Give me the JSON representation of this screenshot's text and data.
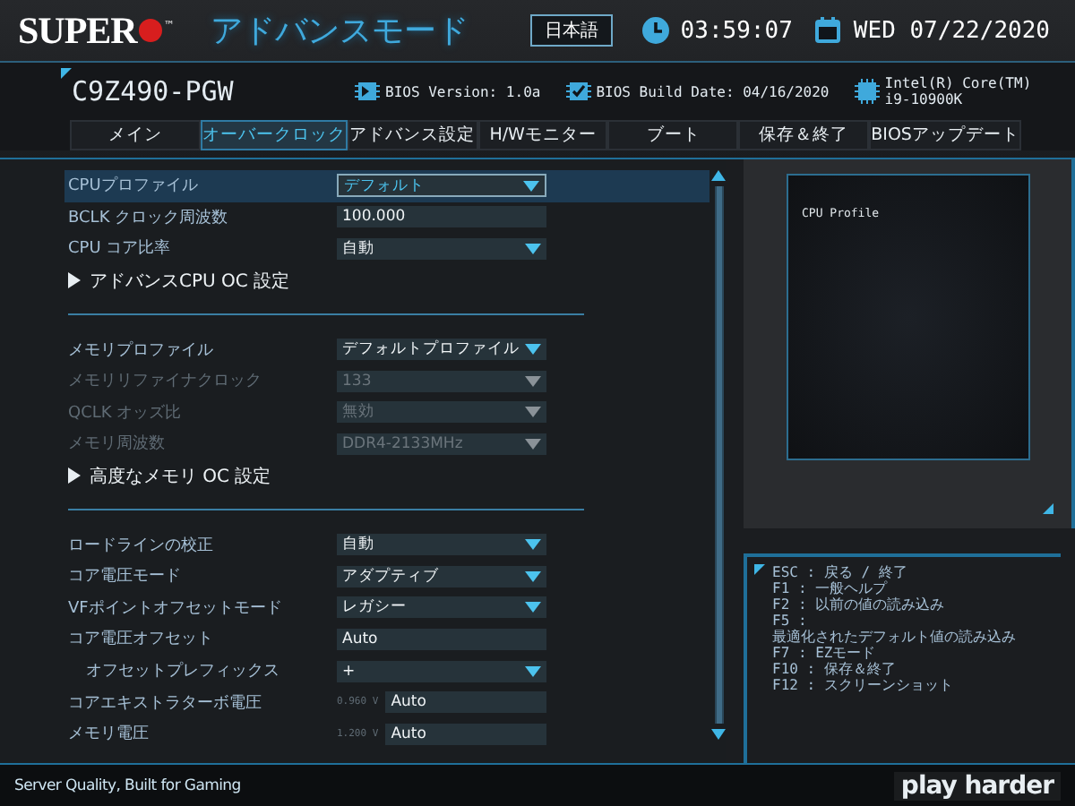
{
  "header": {
    "brand": "SUPER",
    "trademark": "™",
    "mode_title": "アドバンスモード",
    "language_button": "日本語",
    "time": "03:59:07",
    "date": "WED 07/22/2020"
  },
  "info": {
    "model": "C9Z490-PGW",
    "bios_version": "BIOS Version: 1.0a",
    "build_date": "BIOS Build Date: 04/16/2020",
    "cpu_lines": [
      "Intel(R) Core(TM)",
      "i9-10900K"
    ]
  },
  "tabs": [
    {
      "label": "メイン",
      "selected": false
    },
    {
      "label": "オーバークロック",
      "selected": true
    },
    {
      "label": "アドバンス設定",
      "selected": false
    },
    {
      "label": "H/Wモニター",
      "selected": false
    },
    {
      "label": "ブート",
      "selected": false
    },
    {
      "label": "保存＆終了",
      "selected": false
    },
    {
      "label": "BIOSアップデート",
      "selected": false
    }
  ],
  "setting_groups": [
    [
      {
        "kind": "dropdown",
        "label": "CPUプロファイル",
        "value": "デフォルト",
        "disabled": false,
        "selected": true
      },
      {
        "kind": "input",
        "label": "BCLK クロック周波数",
        "value": "100.000",
        "disabled": false,
        "selected": false
      },
      {
        "kind": "dropdown",
        "label": "CPU コア比率",
        "value": "自動",
        "disabled": false,
        "selected": false
      },
      {
        "kind": "submenu",
        "label": "アドバンスCPU OC 設定",
        "disabled": false,
        "selected": false
      }
    ],
    [
      {
        "kind": "dropdown",
        "label": "メモリプロファイル",
        "value": "デフォルトプロファイル",
        "disabled": false,
        "selected": false
      },
      {
        "kind": "dropdown",
        "label": "メモリリファイナクロック",
        "value": "133",
        "disabled": true,
        "selected": false
      },
      {
        "kind": "dropdown",
        "label": "QCLK オッズ比",
        "value": "無効",
        "disabled": true,
        "selected": false
      },
      {
        "kind": "dropdown",
        "label": "メモリ周波数",
        "value": "DDR4-2133MHz",
        "disabled": true,
        "selected": false
      },
      {
        "kind": "submenu",
        "label": "高度なメモリ OC 設定",
        "disabled": false,
        "selected": false
      }
    ],
    [
      {
        "kind": "dropdown",
        "label": "ロードラインの校正",
        "value": "自動",
        "disabled": false,
        "selected": false
      },
      {
        "kind": "dropdown",
        "label": "コア電圧モード",
        "value": "アダプティブ",
        "disabled": false,
        "selected": false
      },
      {
        "kind": "dropdown",
        "label": "VFポイントオフセットモード",
        "value": "レガシー",
        "disabled": false,
        "selected": false
      },
      {
        "kind": "input",
        "label": "コア電圧オフセット",
        "value": "Auto",
        "disabled": false,
        "selected": false
      },
      {
        "kind": "dropdown",
        "label": "オフセットプレフィックス",
        "value": "+",
        "disabled": false,
        "selected": false,
        "indented": true
      },
      {
        "kind": "input",
        "label": "コアエキストラターボ電圧",
        "reading": "0.960 V",
        "value": "Auto",
        "disabled": false,
        "selected": false
      },
      {
        "kind": "input",
        "label": "メモリ電圧",
        "reading": "1.200 V",
        "value": "Auto",
        "disabled": false,
        "selected": false
      }
    ]
  ],
  "help": {
    "text": "CPU Profile"
  },
  "key_help": [
    "ESC : 戻る / 終了",
    "F1  : 一般ヘルプ",
    "F2  : 以前の値の読み込み",
    "F5  :",
    "最適化されたデフォルト値の読み込み",
    "F7  : EZモード",
    "F10 : 保存＆終了",
    "F12 : スクリーンショット"
  ],
  "footer": {
    "slogan": "Server Quality, Built for Gaming",
    "tagline": "play harder"
  }
}
